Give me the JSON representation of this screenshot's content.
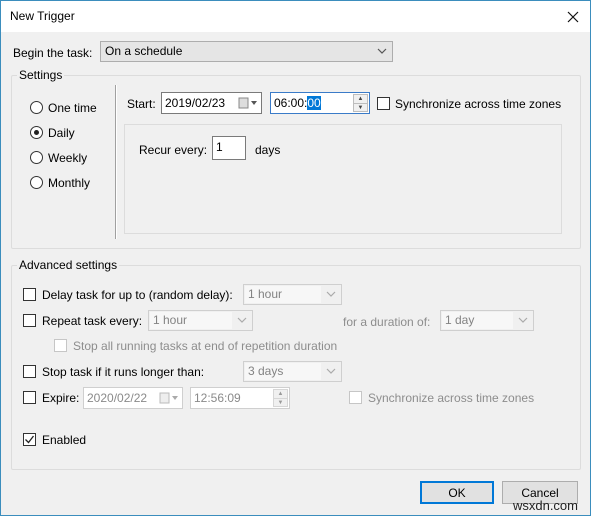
{
  "window": {
    "title": "New Trigger",
    "close_icon": "close-icon"
  },
  "begin_task": {
    "label": "Begin the task:",
    "value": "On a schedule"
  },
  "settings": {
    "group_label": "Settings",
    "schedule_options": [
      {
        "label": "One time",
        "checked": false
      },
      {
        "label": "Daily",
        "checked": true
      },
      {
        "label": "Weekly",
        "checked": false
      },
      {
        "label": "Monthly",
        "checked": false
      }
    ],
    "start_label": "Start:",
    "start_date": "2019/02/23",
    "start_time_prefix": "06:00:",
    "start_time_selected": "00",
    "sync_label": "Synchronize across time zones",
    "sync_checked": false,
    "recur_label": "Recur every:",
    "recur_value": "1",
    "recur_unit": "days"
  },
  "advanced": {
    "group_label": "Advanced settings",
    "delay": {
      "label": "Delay task for up to (random delay):",
      "checked": false,
      "value": "1 hour"
    },
    "repeat": {
      "label": "Repeat task every:",
      "checked": false,
      "value": "1 hour",
      "duration_label": "for a duration of:",
      "duration_value": "1 day"
    },
    "stop_all": {
      "label": "Stop all running tasks at end of repetition duration",
      "checked": false
    },
    "stop_longer": {
      "label": "Stop task if it runs longer than:",
      "checked": false,
      "value": "3 days"
    },
    "expire": {
      "label": "Expire:",
      "checked": false,
      "date": "2020/02/22",
      "time": "12:56:09",
      "sync_label": "Synchronize across time zones",
      "sync_checked": false
    },
    "enabled": {
      "label": "Enabled",
      "checked": true
    }
  },
  "buttons": {
    "ok": "OK",
    "cancel": "Cancel"
  },
  "watermark": "wsxdn.com"
}
